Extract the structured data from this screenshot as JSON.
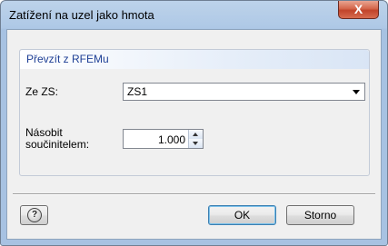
{
  "window": {
    "title": "Zatížení na uzel jako hmota",
    "close_glyph": "X"
  },
  "group": {
    "label": "Převzít z RFEMu",
    "from_label": "Ze ZS:",
    "from_value": "ZS1",
    "multiply_label_line1": "Násobit",
    "multiply_label_line2": "součinitelem:",
    "multiply_value": "1.000"
  },
  "buttons": {
    "help_glyph": "?",
    "ok": "OK",
    "storno": "Storno"
  }
}
